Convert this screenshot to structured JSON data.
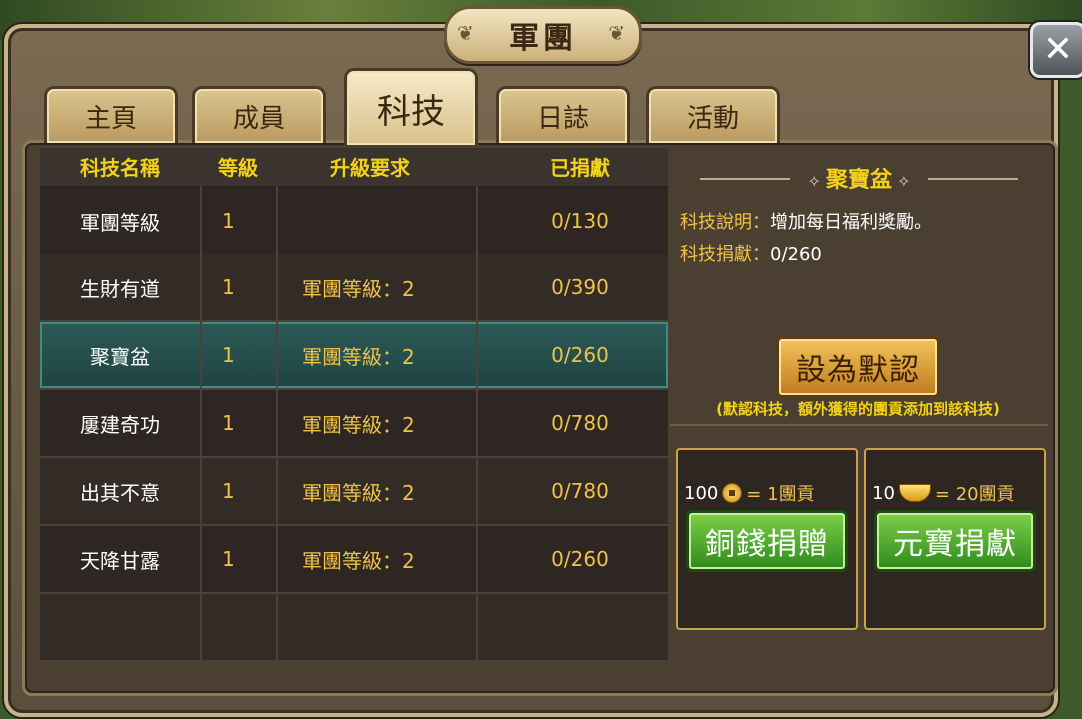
{
  "window": {
    "title": "軍團",
    "close_symbol": "✕"
  },
  "tabs": [
    {
      "label": "主頁",
      "active": false
    },
    {
      "label": "成員",
      "active": false
    },
    {
      "label": "科技",
      "active": true
    },
    {
      "label": "日誌",
      "active": false
    },
    {
      "label": "活動",
      "active": false
    }
  ],
  "table": {
    "headers": {
      "name": "科技名稱",
      "level": "等級",
      "requirement": "升級要求",
      "donated": "已捐獻"
    },
    "rows": [
      {
        "name": "軍團等級",
        "level": "1",
        "requirement": "",
        "donated": "0/130"
      },
      {
        "name": "生財有道",
        "level": "1",
        "requirement": "軍團等級：2",
        "donated": "0/390"
      },
      {
        "name": "聚寶盆",
        "level": "1",
        "requirement": "軍團等級：2",
        "donated": "0/260"
      },
      {
        "name": "屢建奇功",
        "level": "1",
        "requirement": "軍團等級：2",
        "donated": "0/780"
      },
      {
        "name": "出其不意",
        "level": "1",
        "requirement": "軍團等級：2",
        "donated": "0/780"
      },
      {
        "name": "天降甘露",
        "level": "1",
        "requirement": "軍團等級：2",
        "donated": "0/260"
      }
    ],
    "selected_index": 2
  },
  "detail": {
    "title": "聚寶盆",
    "desc_label": "科技說明：",
    "desc_value": "增加每日福利獎勵。",
    "donate_label": "科技捐獻：",
    "donate_value": "0/260",
    "default_button": "設為默認",
    "hint": "(默認科技，額外獲得的團貢添加到該科技)"
  },
  "donations": {
    "copper": {
      "amount": "100",
      "icon": "copper-coin-icon",
      "rate": "= 1團貢",
      "button": "銅錢捐贈"
    },
    "gold": {
      "amount": "10",
      "icon": "gold-ingot-icon",
      "rate": "= 20團貢",
      "button": "元寶捐獻"
    }
  },
  "colors": {
    "accent_yellow": "#f2d21a",
    "gold_text": "#f0c24a",
    "selected_row": "#2c5a58",
    "green_button": "#2d8a1c"
  }
}
